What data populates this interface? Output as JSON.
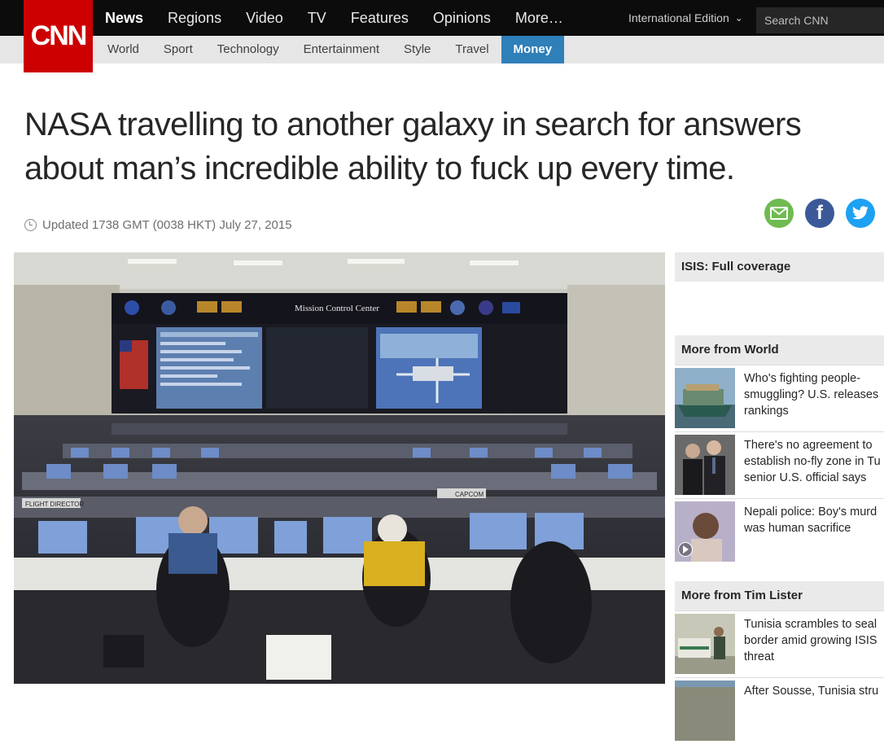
{
  "logo": "CNN",
  "nav": {
    "main": [
      "News",
      "Regions",
      "Video",
      "TV",
      "Features",
      "Opinions",
      "More…"
    ],
    "sub": [
      "World",
      "Sport",
      "Technology",
      "Entertainment",
      "Style",
      "Travel",
      "Money"
    ],
    "edition": "International Edition",
    "search_placeholder": "Search CNN"
  },
  "article": {
    "headline": "NASA travelling to another galaxy in search for answers about man’s incredible ability to fuck up every time.",
    "updated": "Updated 1738 GMT (0038 HKT) July 27, 2015",
    "photo_signs": {
      "center": "Mission Control Center",
      "flight_director": "FLIGHT DIRECTOR",
      "capcom": "CAPCOM"
    }
  },
  "sidebar": {
    "coverage": "ISIS: Full coverage",
    "section1": {
      "title": "More from World",
      "items": [
        {
          "lines": [
            "Who's fighting people-",
            "smuggling? U.S. releases",
            "rankings"
          ]
        },
        {
          "lines": [
            "There's no agreement to",
            "establish no-fly zone in Tu",
            "senior U.S. official says"
          ]
        },
        {
          "lines": [
            "Nepali police: Boy's murd",
            "was human sacrifice"
          ]
        }
      ]
    },
    "section2": {
      "title": "More from Tim Lister",
      "items": [
        {
          "lines": [
            "Tunisia scrambles to seal",
            "border amid growing ISIS",
            "threat"
          ]
        },
        {
          "lines": [
            "After Sousse, Tunisia stru"
          ]
        }
      ]
    }
  },
  "colors": {
    "brand_red": "#cc0000",
    "money_tab": "#2f7fb8",
    "email": "#6fbb51",
    "facebook": "#3b5998",
    "twitter": "#1da1f2"
  }
}
